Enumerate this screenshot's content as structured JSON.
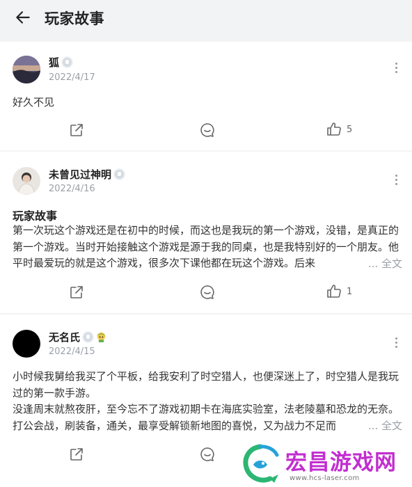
{
  "header": {
    "title": "玩家故事"
  },
  "posts": [
    {
      "username": "狐",
      "date": "2022/4/17",
      "text": "好久不见",
      "likes": "5"
    },
    {
      "username": "未曾见过神明",
      "date": "2022/4/16",
      "title": "玩家故事",
      "text": "第一次玩这个游戏还是在初中的时候，而这也是我玩的第一个游戏，没错，是真正的第一个游戏。当时开始接触这个游戏是源于我的同桌，也是我特别好的一个朋友。他平时最爱玩的就是这个游戏，很多次下课他都在玩这个游戏。后来",
      "more_label": "... 全文",
      "likes": "1"
    },
    {
      "username": "无名氏",
      "date": "2022/4/15",
      "text_line1": "小时候我舅给我买了个平板，给我安利了时空猎人，也便深迷上了，时空猎人是我玩过的第一款手游。",
      "text_line2": "没逢周末就熬夜肝，至今忘不了游戏初期卡在海底实验室，法老陵墓和恐龙的无奈。打公会战，刷装备，通关，最享受解锁新地图的喜悦，又为战力不足而",
      "more_label": "... 全文"
    }
  ],
  "watermark": {
    "text": "宏昌游戏网",
    "url": "www.hcs-laser.com"
  },
  "colors": {
    "accent_logo": "#c22ed0",
    "muted": "#9aa0a8",
    "page_bg": "#f2f3f5"
  }
}
